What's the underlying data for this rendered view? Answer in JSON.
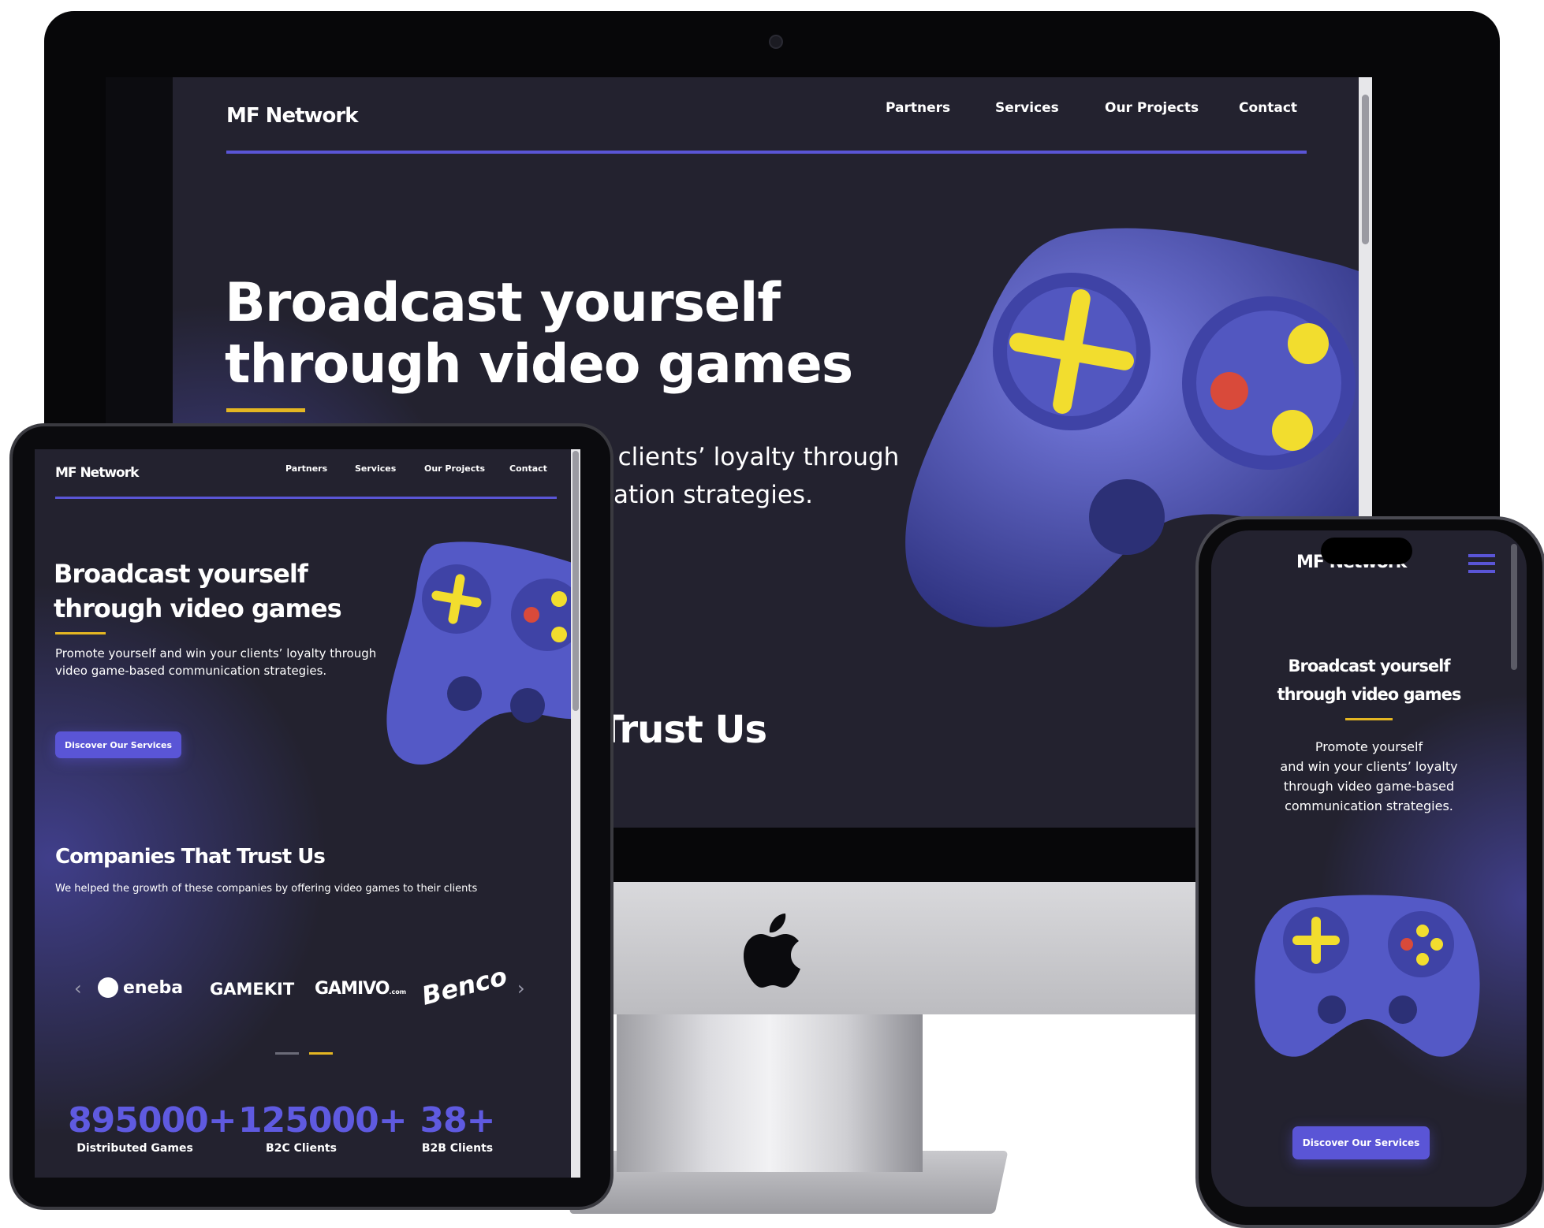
{
  "brand": "MF Network",
  "nav": [
    "Partners",
    "Services",
    "Our Projects",
    "Contact"
  ],
  "hero": {
    "title_line1": "Broadcast yourself",
    "title_line2": "through video games",
    "desktop_sub_line1": "r clients’ loyalty through",
    "desktop_sub_line2": "cation strategies.",
    "desc_line1": "Promote yourself and win your clients’ loyalty through",
    "desc_line2": "video game-based communication strategies.",
    "cta": "Discover Our Services"
  },
  "desktop_partial_heading": "Trust Us",
  "companies": {
    "title": "Companies That Trust Us",
    "subtitle": "We helped the growth of these companies by offering video games to their clients",
    "logos": [
      "eneba",
      "GAMEKIT",
      "GAMIVO",
      "Benco"
    ],
    "logo_small_suffix": ".com"
  },
  "stats": [
    {
      "value": "895000+",
      "label": "Distributed Games"
    },
    {
      "value": "125000+",
      "label": "B2C Clients"
    },
    {
      "value": "38+",
      "label": "B2B Clients"
    }
  ],
  "phone": {
    "brand": "MF Network",
    "title_line1": "Broadcast yourself",
    "title_line2": "through video games",
    "desc_lines": [
      "Promote yourself",
      "and win your clients’ loyalty",
      "through video game-based",
      "communication strategies."
    ],
    "cta": "Discover Our Services"
  },
  "colors": {
    "background": "#23222f",
    "accent": "#5a55d6",
    "underline_yellow": "#e4b622",
    "controller": "#5b5fc7",
    "controller_buttons": "#f2dd2e",
    "controller_red": "#d94a3a"
  },
  "icons": [
    "apple-logo-icon",
    "chevron-left-icon",
    "chevron-right-icon",
    "hamburger-menu-icon",
    "game-controller-icon"
  ]
}
